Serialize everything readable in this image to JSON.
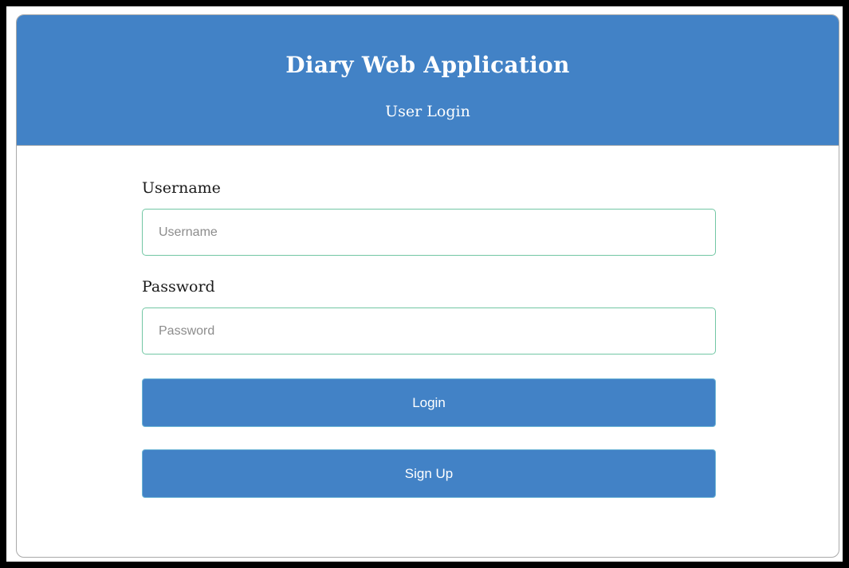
{
  "header": {
    "title": "Diary Web Application",
    "subtitle": "User Login"
  },
  "form": {
    "username_label": "Username",
    "username_placeholder": "Username",
    "username_value": "",
    "password_label": "Password",
    "password_placeholder": "Password",
    "password_value": "",
    "login_label": "Login",
    "signup_label": "Sign Up"
  },
  "colors": {
    "primary": "#4282c6",
    "input_border": "#72c7a4",
    "page_border": "#000000"
  }
}
